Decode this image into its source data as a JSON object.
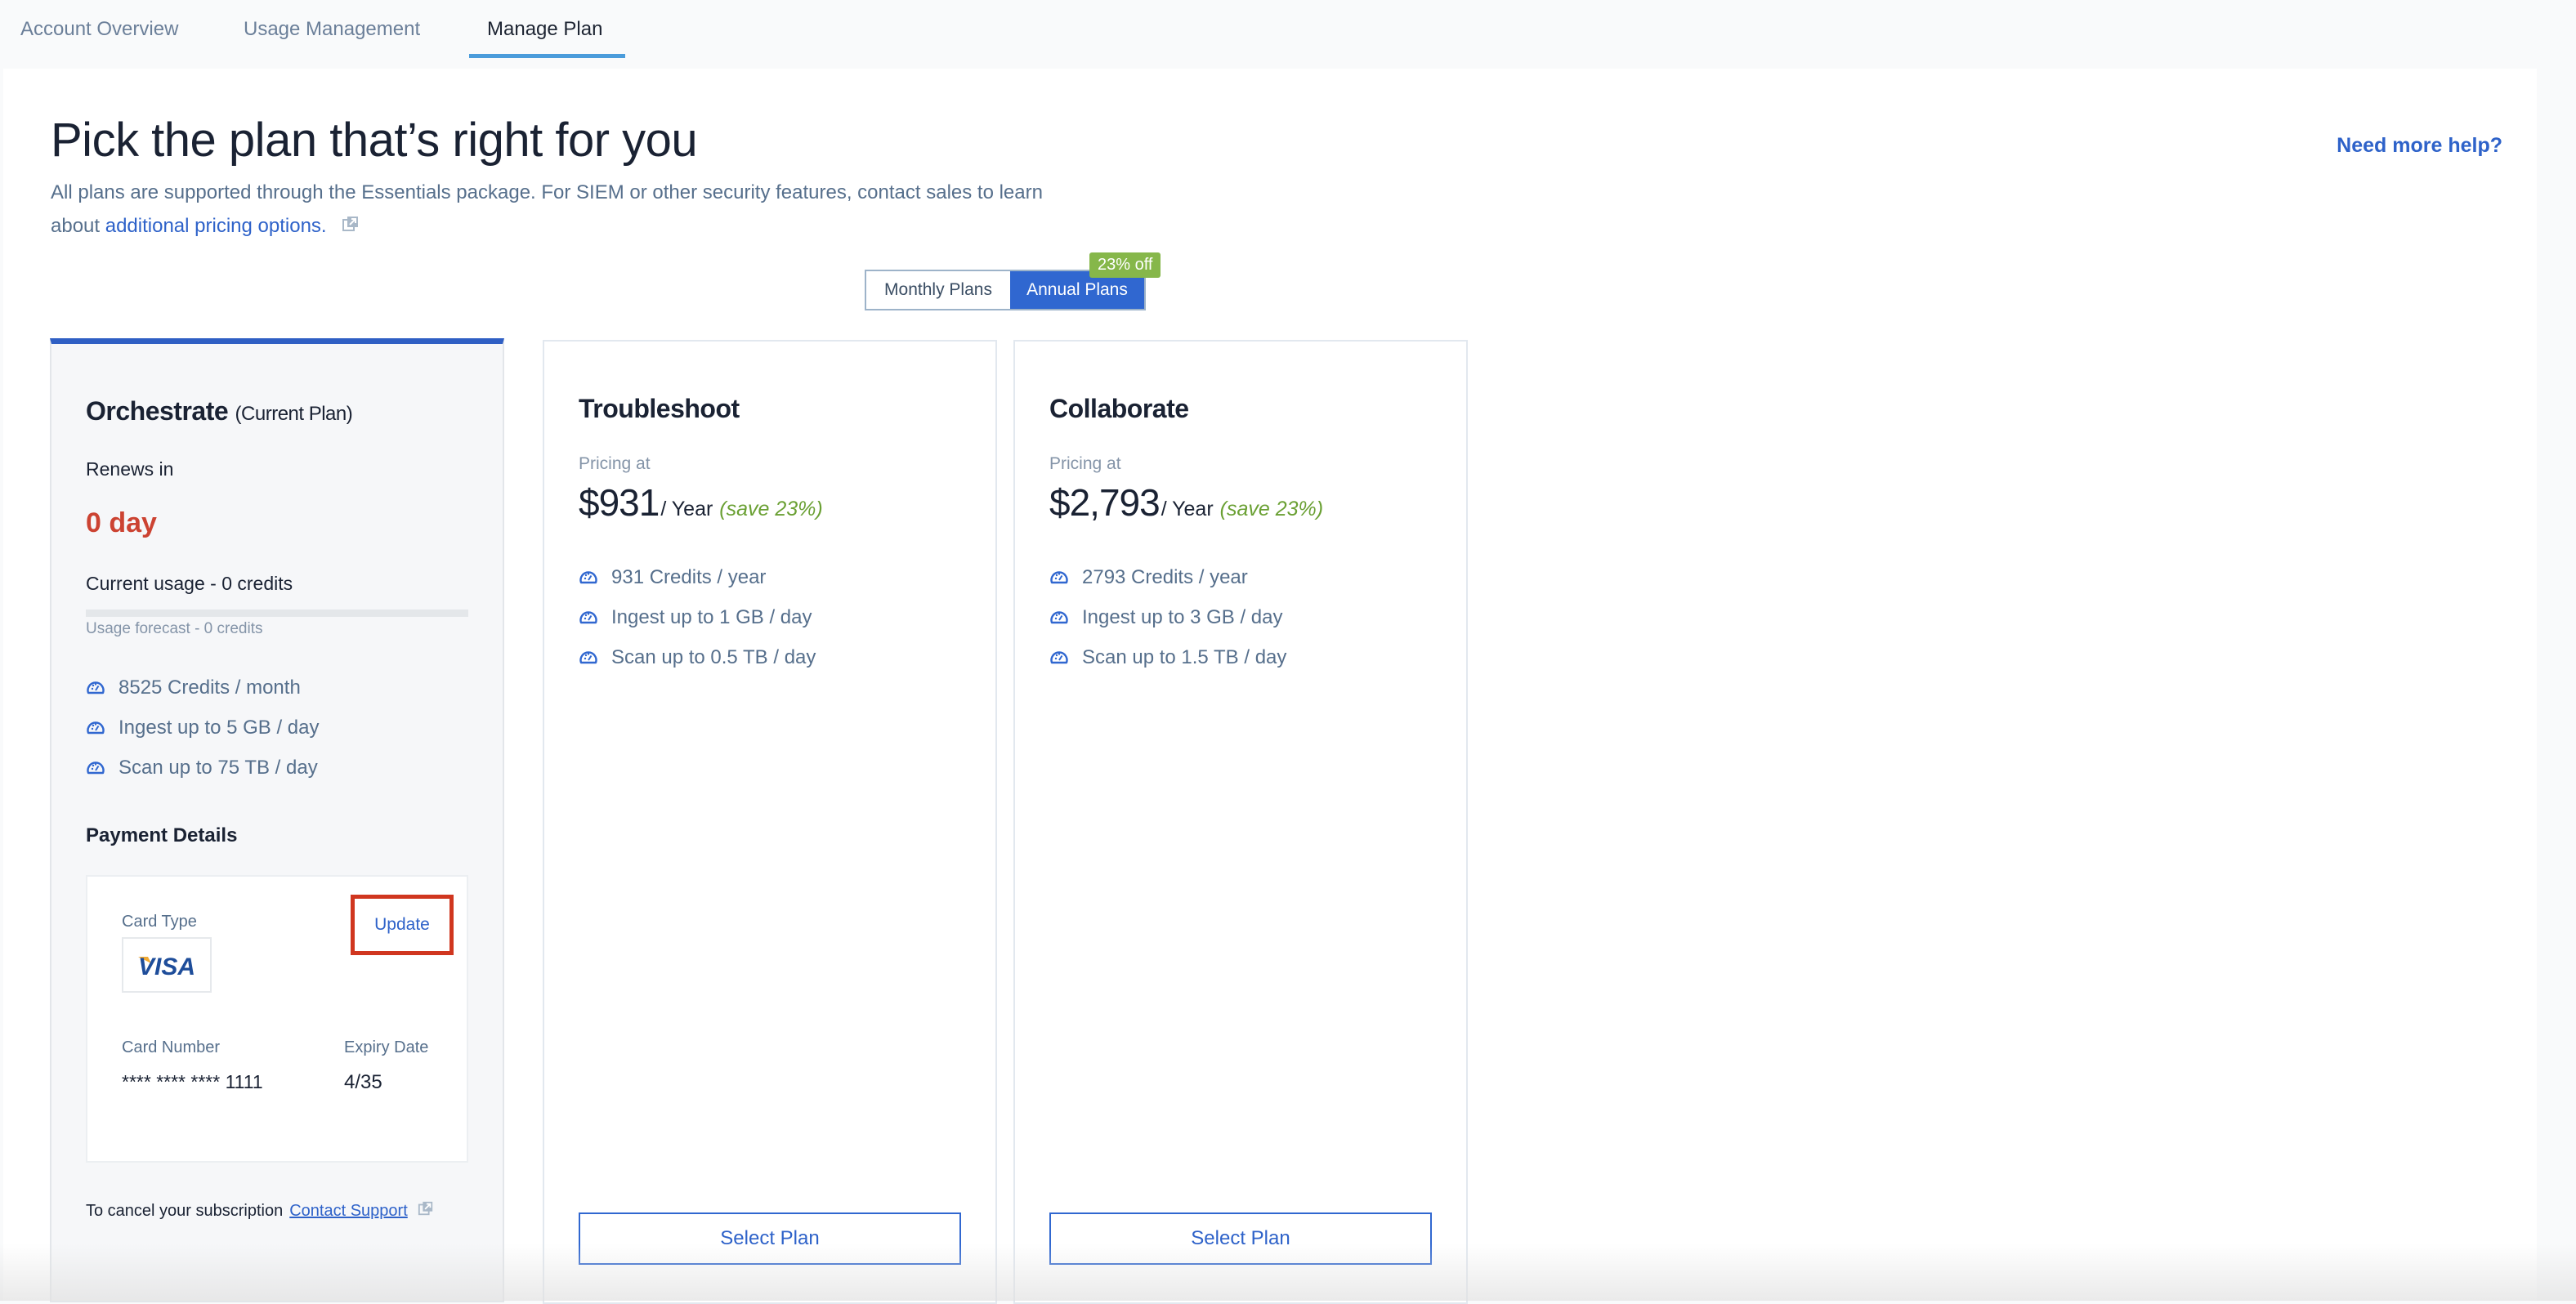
{
  "tabs": [
    {
      "label": "Account Overview",
      "active": false
    },
    {
      "label": "Usage Management",
      "active": false
    },
    {
      "label": "Manage Plan",
      "active": true
    }
  ],
  "header": {
    "title": "Pick the plan that’s right for you",
    "subtitle_text": "All plans are supported through the Essentials package. For SIEM or other security features, contact sales to learn about ",
    "subtitle_link": "additional pricing options.",
    "help_link": "Need more help?"
  },
  "billing_toggle": {
    "options": [
      "Monthly Plans",
      "Annual Plans"
    ],
    "selected": "Annual Plans",
    "badge": "23% off"
  },
  "current_plan": {
    "name": "Orchestrate",
    "tag": "(Current Plan)",
    "renews_label": "Renews in",
    "renews_value": "0 day",
    "usage_label": "Current usage - 0 credits",
    "usage_fraction": 0,
    "forecast_label": "Usage forecast - 0 credits",
    "features": [
      {
        "icon": "speedometer-icon",
        "text": "8525 Credits / month"
      },
      {
        "icon": "speedometer-icon",
        "text": "Ingest up to 5 GB / day"
      },
      {
        "icon": "speedometer-icon",
        "text": "Scan up to 75 TB / day"
      }
    ],
    "payment": {
      "title": "Payment Details",
      "card_type_label": "Card Type",
      "card_brand": "VISA",
      "update_label": "Update",
      "card_number_label": "Card Number",
      "card_number": "**** **** **** 1111",
      "expiry_label": "Expiry Date",
      "expiry": "4/35"
    },
    "cancel_text": "To cancel your subscription",
    "cancel_link": "Contact Support"
  },
  "plans": [
    {
      "name": "Troubleshoot",
      "pricing_label": "Pricing at",
      "price": "$931",
      "period": "/ Year",
      "save": "(save 23%)",
      "features": [
        {
          "icon": "speedometer-icon",
          "text": "931 Credits / year"
        },
        {
          "icon": "speedometer-icon",
          "text": "Ingest up to 1 GB / day"
        },
        {
          "icon": "speedometer-icon",
          "text": "Scan up to 0.5 TB / day"
        }
      ],
      "button": "Select Plan"
    },
    {
      "name": "Collaborate",
      "pricing_label": "Pricing at",
      "price": "$2,793",
      "period": "/ Year",
      "save": "(save 23%)",
      "features": [
        {
          "icon": "speedometer-icon",
          "text": "2793 Credits / year"
        },
        {
          "icon": "speedometer-icon",
          "text": "Ingest up to 3 GB / day"
        },
        {
          "icon": "speedometer-icon",
          "text": "Scan up to 1.5 TB / day"
        }
      ],
      "button": "Select Plan"
    }
  ],
  "colors": {
    "accent": "#3067d0",
    "link": "#2e62c9",
    "danger": "#cc4332",
    "success": "#86b74a",
    "highlight_box": "#d0361f"
  }
}
